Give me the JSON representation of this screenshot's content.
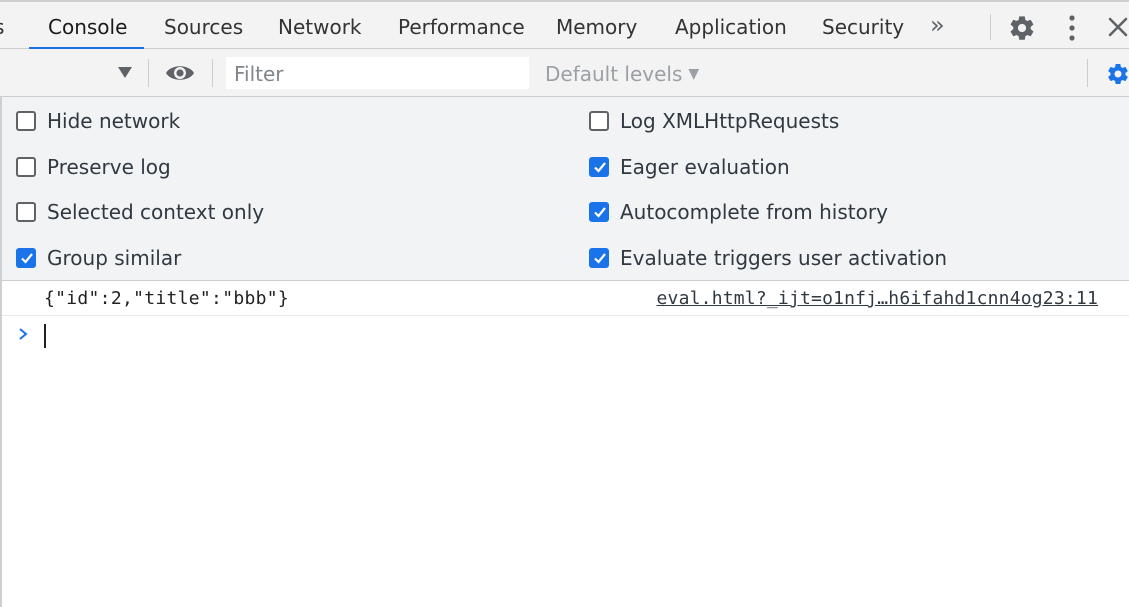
{
  "tabs": [
    {
      "label": "s"
    },
    {
      "label": "Console",
      "selected": true
    },
    {
      "label": "Sources"
    },
    {
      "label": "Network"
    },
    {
      "label": "Performance"
    },
    {
      "label": "Memory"
    },
    {
      "label": "Application"
    },
    {
      "label": "Security"
    }
  ],
  "tabbar_icons": [
    "more-tabs-icon",
    "gear-icon",
    "kebab-menu-icon",
    "close-icon"
  ],
  "toolbar": {
    "filter_placeholder": "Filter",
    "levels_label": "Default levels",
    "icons": [
      "context-dropdown-icon",
      "eye-icon",
      "console-settings-icon"
    ]
  },
  "settings": {
    "left": [
      {
        "label": "Hide network",
        "checked": false
      },
      {
        "label": "Preserve log",
        "checked": false
      },
      {
        "label": "Selected context only",
        "checked": false
      },
      {
        "label": "Group similar",
        "checked": true
      }
    ],
    "right": [
      {
        "label": "Log XMLHttpRequests",
        "checked": false
      },
      {
        "label": "Eager evaluation",
        "checked": true
      },
      {
        "label": "Autocomplete from history",
        "checked": true
      },
      {
        "label": "Evaluate triggers user activation",
        "checked": true
      }
    ]
  },
  "console": {
    "messages": [
      {
        "text": "{\"id\":2,\"title\":\"bbb\"}",
        "source": "eval.html?_ijt=o1nfj…h6ifahd1cnn4og23:11"
      }
    ],
    "prompt_icon": "prompt-chevron-icon"
  },
  "colors": {
    "accent": "#1a73e8",
    "toolbar_bg": "#f3f3f3",
    "settings_bg": "#f1f3f4"
  }
}
